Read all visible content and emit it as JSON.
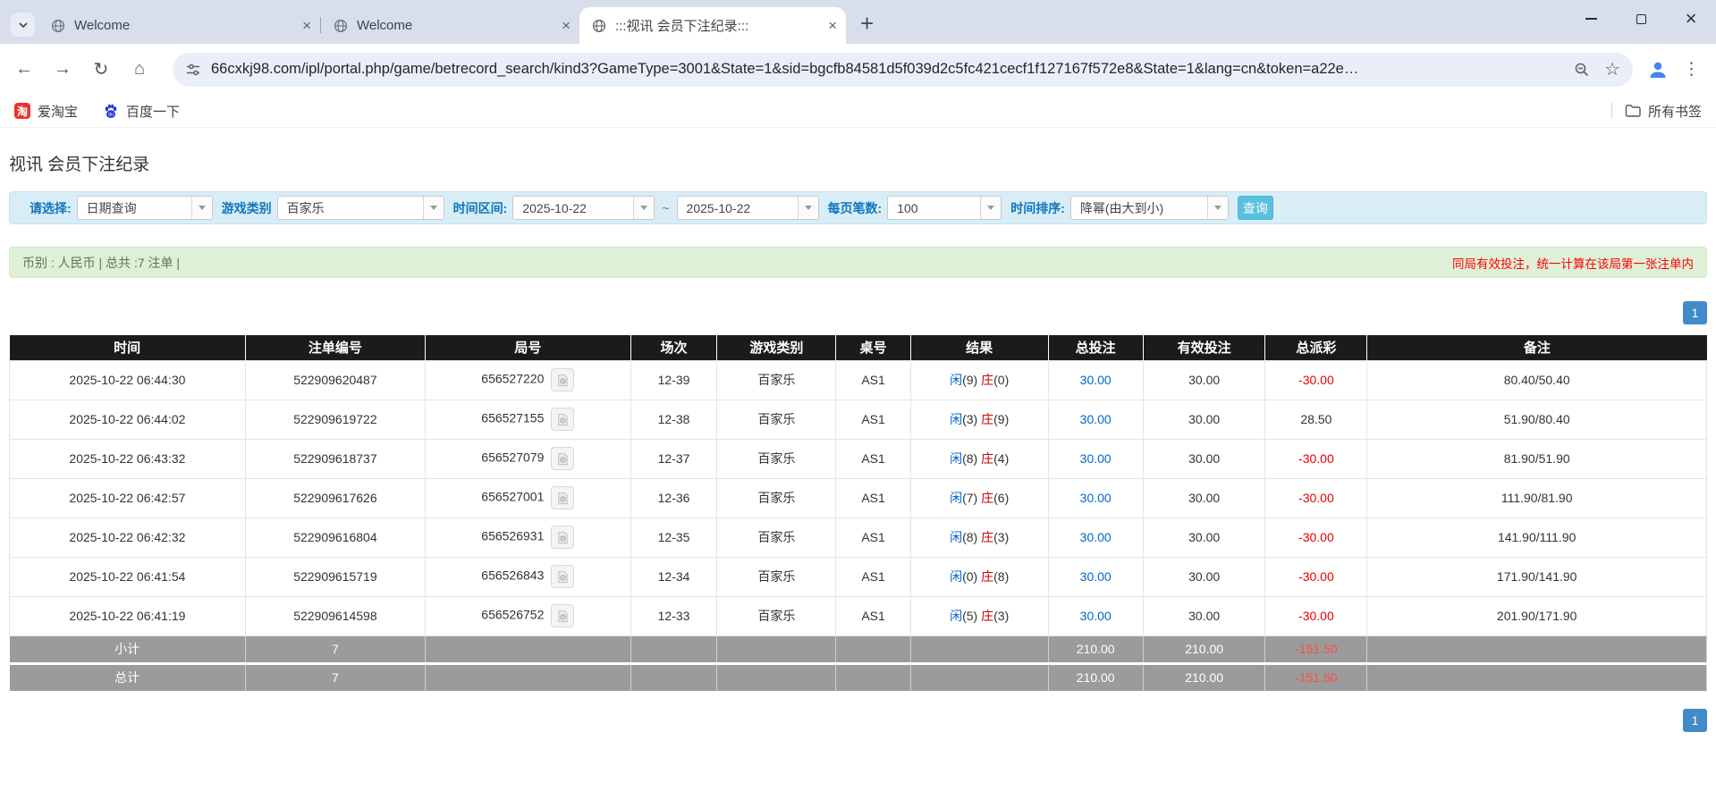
{
  "browser": {
    "tabs": [
      {
        "title": "Welcome"
      },
      {
        "title": "Welcome"
      },
      {
        "title": ":::视讯 会员下注纪录:::"
      }
    ],
    "url": "66cxkj98.com/ipl/portal.php/game/betrecord_search/kind3?GameType=3001&State=1&sid=bgcfb84581d5f039d2c5fc421cecf1f127167f572e8&State=1&lang=cn&token=a22e…",
    "bookmarks": {
      "taobao": "爱淘宝",
      "taobao_icon_char": "淘",
      "baidu": "百度一下",
      "all": "所有书签"
    },
    "new_tab": "+"
  },
  "page": {
    "title": "视讯 会员下注纪录",
    "filters": {
      "select_label": "请选择:",
      "select_value": "日期查询",
      "game_label": "游戏类别",
      "game_value": "百家乐",
      "range_label": "时间区间:",
      "date_from": "2025-10-22",
      "tilde": "~",
      "date_to": "2025-10-22",
      "per_page_label": "每页笔数:",
      "per_page_value": "100",
      "sort_label": "时间排序:",
      "sort_value": "降幂(由大到小)",
      "search_button": "查询"
    },
    "summary": {
      "left": "币别 : 人民币 | 总共 :7 注单 |",
      "right": "同局有效投注，统一计算在该局第一张注单内"
    },
    "pagination": {
      "page": "1"
    },
    "table": {
      "headers": [
        "时间",
        "注单编号",
        "局号",
        "场次",
        "游戏类别",
        "桌号",
        "结果",
        "总投注",
        "有效投注",
        "总派彩",
        "备注"
      ],
      "rows": [
        {
          "time": "2025-10-22 06:44:30",
          "bet_no": "522909620487",
          "round_no": "656527220",
          "session": "12-39",
          "game": "百家乐",
          "table_no": "AS1",
          "player": "闲",
          "player_pts": "(9)",
          "banker": "庄",
          "banker_pts": "(0)",
          "total_bet": "30.00",
          "valid_bet": "30.00",
          "payout": "-30.00",
          "note": "80.40/50.40"
        },
        {
          "time": "2025-10-22 06:44:02",
          "bet_no": "522909619722",
          "round_no": "656527155",
          "session": "12-38",
          "game": "百家乐",
          "table_no": "AS1",
          "player": "闲",
          "player_pts": "(3)",
          "banker": "庄",
          "banker_pts": "(9)",
          "total_bet": "30.00",
          "valid_bet": "30.00",
          "payout": "28.50",
          "note": "51.90/80.40"
        },
        {
          "time": "2025-10-22 06:43:32",
          "bet_no": "522909618737",
          "round_no": "656527079",
          "session": "12-37",
          "game": "百家乐",
          "table_no": "AS1",
          "player": "闲",
          "player_pts": "(8)",
          "banker": "庄",
          "banker_pts": "(4)",
          "total_bet": "30.00",
          "valid_bet": "30.00",
          "payout": "-30.00",
          "note": "81.90/51.90"
        },
        {
          "time": "2025-10-22 06:42:57",
          "bet_no": "522909617626",
          "round_no": "656527001",
          "session": "12-36",
          "game": "百家乐",
          "table_no": "AS1",
          "player": "闲",
          "player_pts": "(7)",
          "banker": "庄",
          "banker_pts": "(6)",
          "total_bet": "30.00",
          "valid_bet": "30.00",
          "payout": "-30.00",
          "note": "111.90/81.90"
        },
        {
          "time": "2025-10-22 06:42:32",
          "bet_no": "522909616804",
          "round_no": "656526931",
          "session": "12-35",
          "game": "百家乐",
          "table_no": "AS1",
          "player": "闲",
          "player_pts": "(8)",
          "banker": "庄",
          "banker_pts": "(3)",
          "total_bet": "30.00",
          "valid_bet": "30.00",
          "payout": "-30.00",
          "note": "141.90/111.90"
        },
        {
          "time": "2025-10-22 06:41:54",
          "bet_no": "522909615719",
          "round_no": "656526843",
          "session": "12-34",
          "game": "百家乐",
          "table_no": "AS1",
          "player": "闲",
          "player_pts": "(0)",
          "banker": "庄",
          "banker_pts": "(8)",
          "total_bet": "30.00",
          "valid_bet": "30.00",
          "payout": "-30.00",
          "note": "171.90/141.90"
        },
        {
          "time": "2025-10-22 06:41:19",
          "bet_no": "522909614598",
          "round_no": "656526752",
          "session": "12-33",
          "game": "百家乐",
          "table_no": "AS1",
          "player": "闲",
          "player_pts": "(5)",
          "banker": "庄",
          "banker_pts": "(3)",
          "total_bet": "30.00",
          "valid_bet": "30.00",
          "payout": "-30.00",
          "note": "201.90/171.90"
        }
      ],
      "subtotal": {
        "label": "小计",
        "count": "7",
        "total_bet": "210.00",
        "valid_bet": "210.00",
        "payout": "-151.50"
      },
      "total": {
        "label": "总计",
        "count": "7",
        "total_bet": "210.00",
        "valid_bet": "210.00",
        "payout": "-151.50"
      }
    }
  },
  "colors": {
    "accent_blue": "#428bca",
    "search_button": "#5bc0de",
    "filter_bar_bg": "#d9edf7",
    "filter_label": "#0e76bc",
    "summary_bg": "#dff0d8",
    "summary_text": "#567a56",
    "warning_red": "#ff0000",
    "table_header_bg": "#1b1b1b",
    "link_blue": "#0066cc",
    "banker_red": "#cc0000",
    "negative_red": "#e60000",
    "footer_bg": "#9b9b9b"
  }
}
